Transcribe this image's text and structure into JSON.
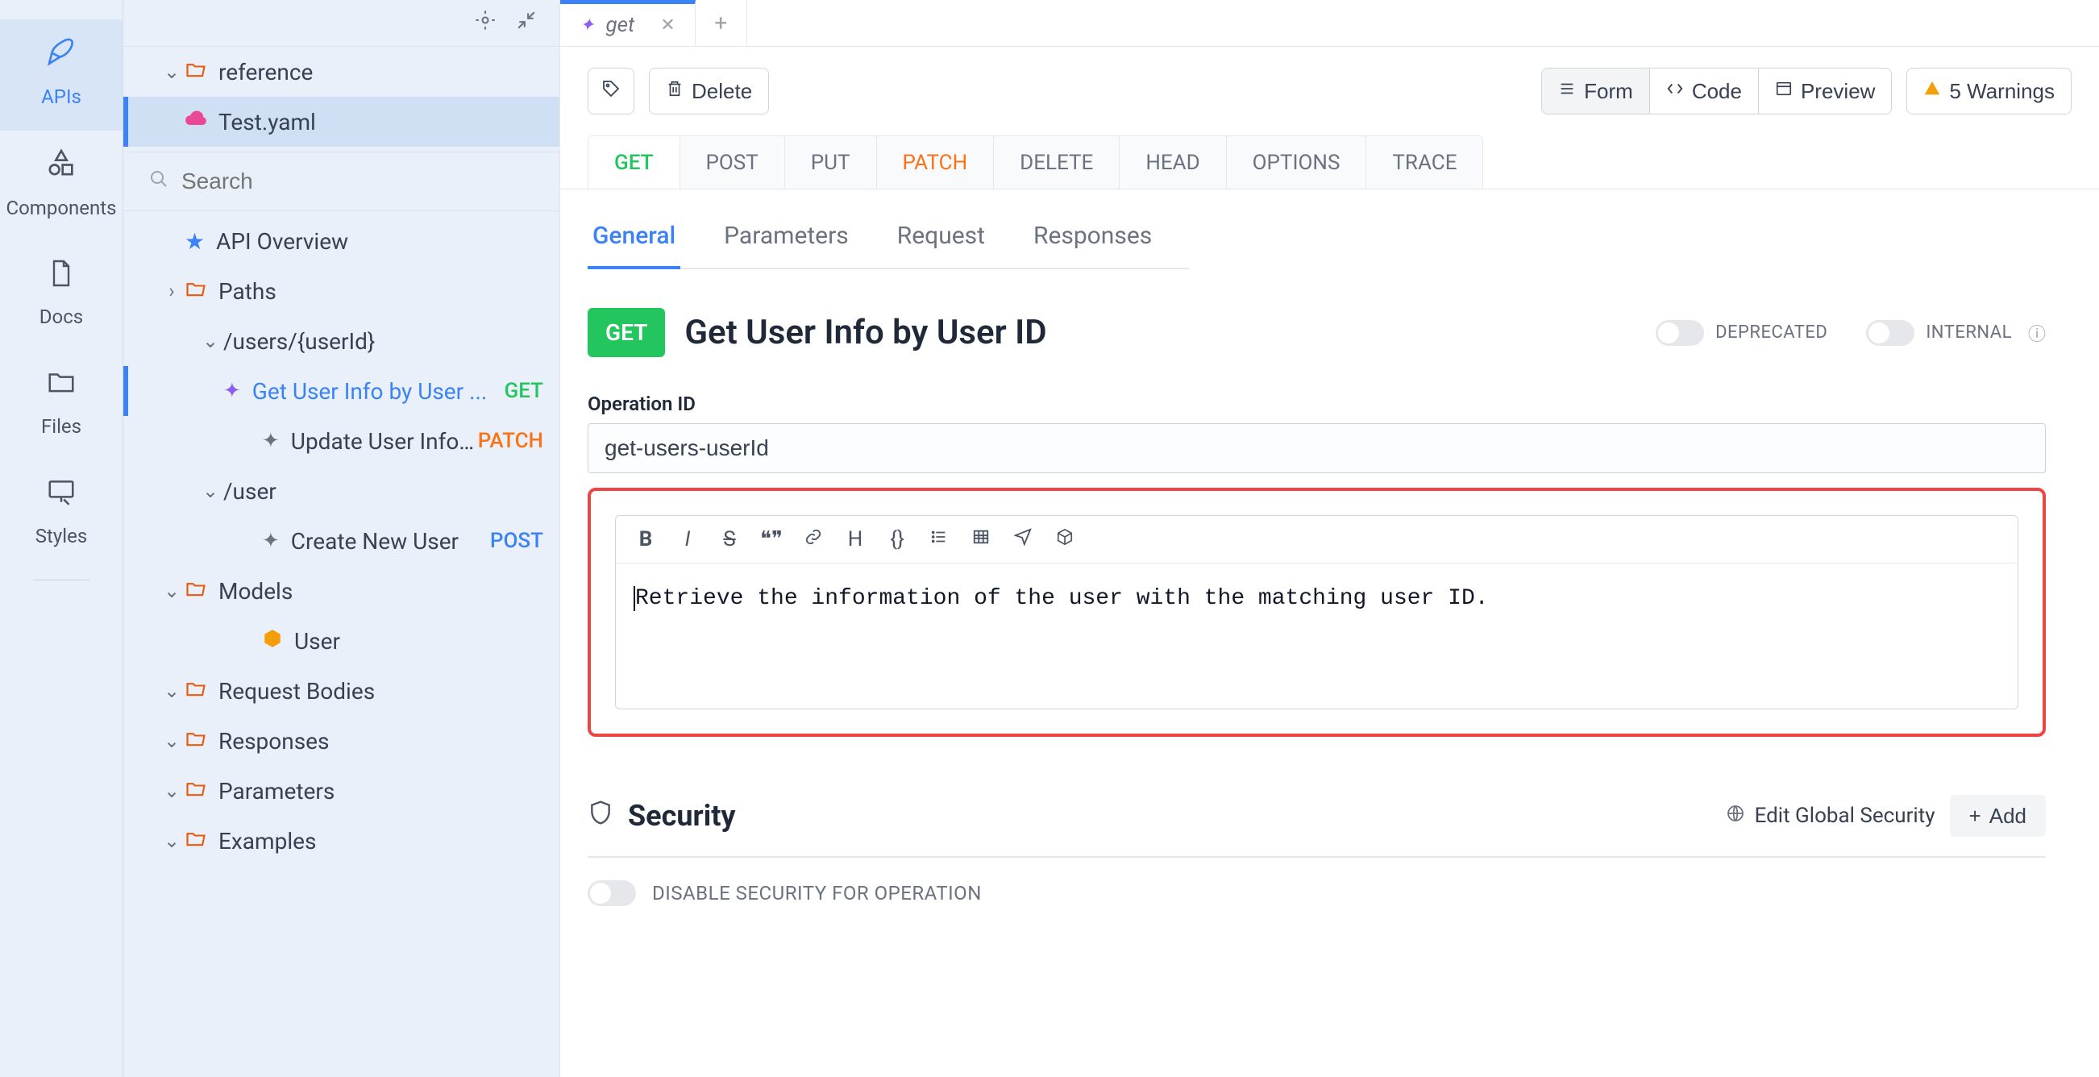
{
  "rail": [
    {
      "label": "APIs",
      "icon": "✒",
      "active": true
    },
    {
      "label": "Components",
      "icon": "△",
      "active": false
    },
    {
      "label": "Docs",
      "icon": "🗎",
      "active": false
    },
    {
      "label": "Files",
      "icon": "🗀",
      "active": false
    },
    {
      "label": "Styles",
      "icon": "🖰",
      "active": false
    }
  ],
  "sidebar": {
    "reference_label": "reference",
    "file_label": "Test.yaml",
    "search_placeholder": "Search",
    "api_overview": "API Overview",
    "paths_label": "Paths",
    "path_users_userid": "/users/{userId}",
    "op_get_user": "Get User Info by User ...",
    "op_get_user_method": "GET",
    "op_update_user": "Update User Inform...",
    "op_update_user_method": "PATCH",
    "path_user": "/user",
    "op_create_user": "Create New User",
    "op_create_user_method": "POST",
    "models_label": "Models",
    "model_user": "User",
    "request_bodies": "Request Bodies",
    "responses": "Responses",
    "parameters": "Parameters",
    "examples": "Examples"
  },
  "tabs": {
    "open_tab": "get"
  },
  "toolbar": {
    "delete": "Delete",
    "form": "Form",
    "code": "Code",
    "preview": "Preview",
    "warnings": "5 Warnings"
  },
  "http_methods": [
    "GET",
    "POST",
    "PUT",
    "PATCH",
    "DELETE",
    "HEAD",
    "OPTIONS",
    "TRACE"
  ],
  "sub_tabs": [
    "General",
    "Parameters",
    "Request",
    "Responses"
  ],
  "operation": {
    "method_badge": "GET",
    "title": "Get User Info by User ID",
    "deprecated_label": "DEPRECATED",
    "internal_label": "INTERNAL",
    "operation_id_label": "Operation ID",
    "operation_id_value": "get-users-userId",
    "description": "Retrieve the information of the user with the matching user ID."
  },
  "security": {
    "title": "Security",
    "edit_global": "Edit Global Security",
    "add": "Add",
    "disable_label": "DISABLE SECURITY FOR OPERATION"
  }
}
